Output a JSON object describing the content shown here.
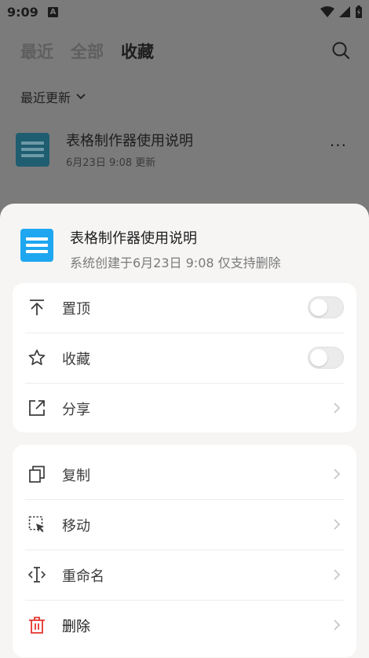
{
  "status_bar": {
    "time": "9:09",
    "badge": "A"
  },
  "tabs": [
    {
      "label": "最近"
    },
    {
      "label": "全部"
    },
    {
      "label": "收藏"
    }
  ],
  "sort": {
    "label": "最近更新"
  },
  "file": {
    "name": "表格制作器使用说明",
    "meta": "6月23日 9:08 更新",
    "more": "···"
  },
  "sheet": {
    "title": "表格制作器使用说明",
    "subtitle": "系统创建于6月23日 9:08 仅支持删除",
    "group1": [
      {
        "label": "置顶",
        "icon": "pin-top-icon",
        "toggle_on": false
      },
      {
        "label": "收藏",
        "icon": "star-icon",
        "toggle_on": false
      },
      {
        "label": "分享",
        "icon": "share-icon"
      }
    ],
    "group2": [
      {
        "label": "复制",
        "icon": "copy-icon"
      },
      {
        "label": "移动",
        "icon": "move-icon"
      },
      {
        "label": "重命名",
        "icon": "rename-icon"
      },
      {
        "label": "删除",
        "icon": "trash-icon"
      }
    ]
  },
  "colors": {
    "accent": "#1ea7f0",
    "danger": "#e5342f",
    "sheet_bg": "#f6f5f4"
  }
}
